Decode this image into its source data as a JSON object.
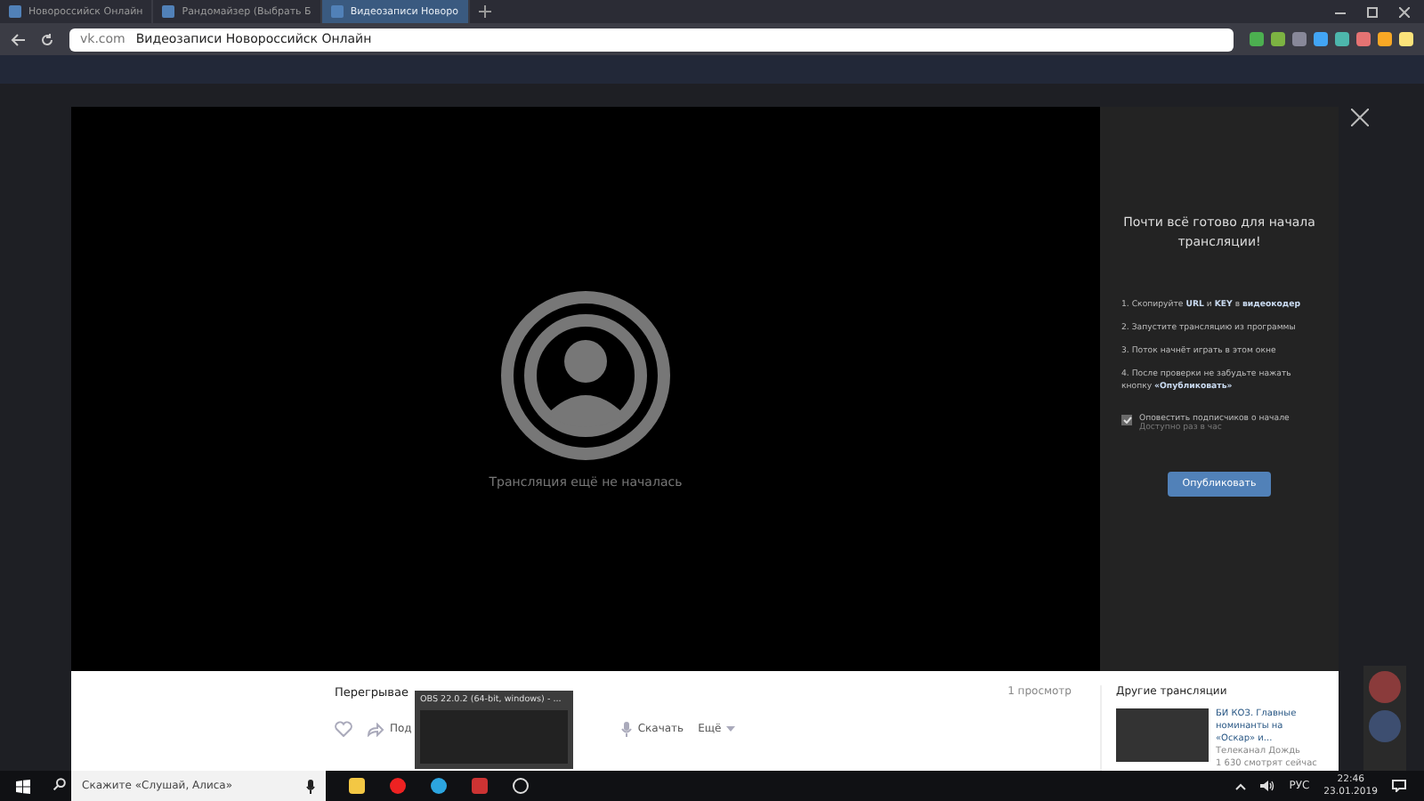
{
  "browser": {
    "tabs": [
      {
        "title": "Новороссийск Онлайн",
        "selected": false
      },
      {
        "title": "Рандомайзер (Выбрать Б",
        "selected": false
      },
      {
        "title": "Видеозаписи Новоро",
        "selected": true
      }
    ],
    "url": {
      "domain": "vk.com",
      "title": "Видеозаписи Новороссийск Онлайн"
    }
  },
  "modal": {
    "live_message": "Трансляция ещё не началась",
    "setup": {
      "title": "Почти всё готово для начала трансляции!",
      "steps": [
        "1. Скопируйте **URL** и **KEY** в **видеокодер**",
        "2. Запустите трансляцию из программы",
        "3. Поток начнёт играть в этом окне",
        "4. После проверки не забудьте нажать кнопку **«Опубликовать»**"
      ],
      "notify": {
        "label": "Оповестить подписчиков о начале",
        "hint": "Доступно раз в час",
        "checked": true
      },
      "publish_button": "Опубликовать"
    },
    "video_title": "Перегрывае",
    "views": "1 просмотр",
    "actions": [
      {
        "kind": "like"
      },
      {
        "kind": "share",
        "label": "Под"
      },
      {
        "kind": "download",
        "label": "Скачать"
      },
      {
        "kind": "more",
        "label": "Ещё"
      }
    ],
    "other_streams": {
      "heading": "Другие трансляции",
      "items": [
        {
          "title": "БИ КОЗ. Главные номинанты на «Оскар» и...",
          "channel": "Телеканал Дождь",
          "viewers": "1 630 смотрят сейчас"
        }
      ]
    }
  },
  "taskbar": {
    "search": {
      "placeholder": "Скажите «Слушай, Алиса»"
    },
    "preview": {
      "title": "OBS 22.0.2 (64-bit, windows) - ..."
    },
    "language": "РУС",
    "time": "22:46",
    "date": "23.01.2019"
  }
}
